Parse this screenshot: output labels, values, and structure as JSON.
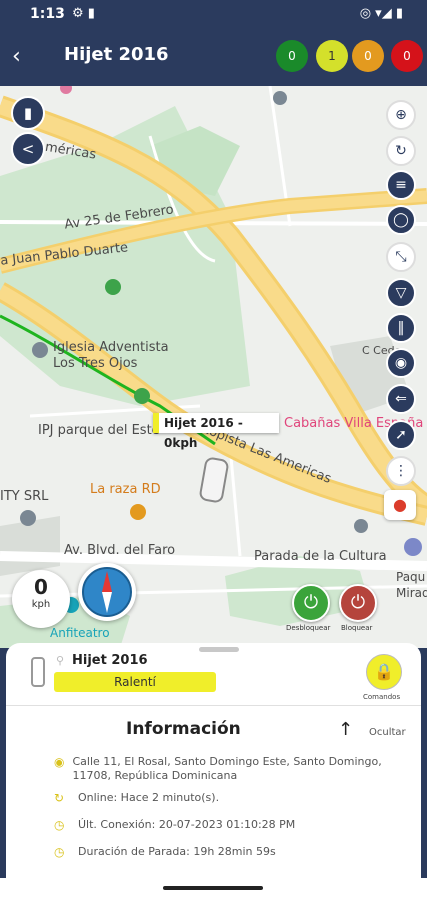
{
  "status_bar": {
    "time": "1:13",
    "left_icons": "⚙ ▮",
    "right_icons": "◎ ▾◢ ▮"
  },
  "header": {
    "title": "Hijet 2016",
    "counters": [
      {
        "value": "0",
        "color": "#1a8a2a"
      },
      {
        "value": "1",
        "color": "#d4e02b"
      },
      {
        "value": "0",
        "color": "#e39a1f"
      },
      {
        "value": "0",
        "color": "#d5121a"
      }
    ]
  },
  "map": {
    "labels": {
      "americas_top": "Américas",
      "av25": "Av 25 de Febrero",
      "juan_pablo": "a Juan Pablo Duarte",
      "iglesia_1": "Iglesia Adventista",
      "iglesia_2": "Los Tres Ojos",
      "ipj": "IPJ parque del Este",
      "autopista": "topista Las Americas",
      "cabanas": "Cabañas Villa España",
      "c_cede": "C Cede",
      "ity": "ITY SRL",
      "raza": "La raza RD",
      "bulevar": "Av. Blvd. del Faro",
      "parada": "Parada de la Cultura",
      "paque": "Paqu",
      "mirad": "Mirad",
      "anfiteatro": "Anfiteatro"
    },
    "marker_label": "Hijet 2016 - 0kph",
    "speed": {
      "value": "0",
      "unit": "kph"
    },
    "actions": {
      "unlock_label": "Desbloquear",
      "lock_label": "Bloquear"
    }
  },
  "sheet": {
    "vehicle_name": "Hijet 2016",
    "status": "Ralentí",
    "commands_label": "Comandos",
    "info_title": "Información",
    "hide_label": "Ocultar",
    "rows": [
      {
        "icon": "pin-icon",
        "text": "Calle 11, El Rosal, Santo Domingo Este, Santo Domingo, 11708, República Dominicana"
      },
      {
        "icon": "signal-icon",
        "text": "Online: Hace 2 minuto(s)."
      },
      {
        "icon": "clock-icon",
        "text": "Últ. Conexión: 20-07-2023 01:10:28 PM"
      },
      {
        "icon": "clock-icon",
        "text": "Duración de Parada: 19h 28min 59s"
      }
    ]
  }
}
